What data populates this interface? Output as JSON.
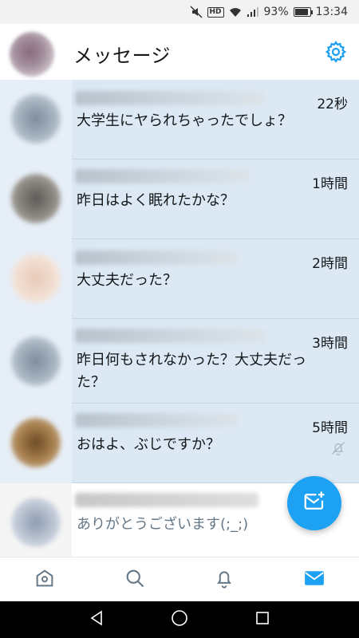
{
  "status_bar": {
    "battery": "93%",
    "time": "13:34",
    "hd_label": "HD",
    "battery_level": 0.93
  },
  "header": {
    "title": "メッセージ"
  },
  "conversations": [
    {
      "time": "22秒",
      "message": "大学生にヤられちゃったでしょ？"
    },
    {
      "time": "1時間",
      "message": "昨日はよく眠れたかな？"
    },
    {
      "time": "2時間",
      "message": "大丈夫だった？"
    },
    {
      "time": "3時間",
      "message": "昨日何もされなかった？大丈夫だった？"
    },
    {
      "time": "5時間",
      "message": "おはよ、ぶじですか？"
    },
    {
      "message": "ありがとうございます(;_;)"
    }
  ],
  "icons": {
    "settings": "gear-icon",
    "compose": "new-message-icon",
    "mute": "bell-off-icon",
    "tabs": [
      "home-icon",
      "search-icon",
      "notifications-icon",
      "messages-icon"
    ],
    "nav": [
      "back-icon",
      "home-circle-icon",
      "recents-icon"
    ]
  },
  "colors": {
    "accent": "#1da1f2",
    "unread_row": "#dce9f5",
    "tab_active": "#1da1f2",
    "tab_inactive": "#657786"
  }
}
